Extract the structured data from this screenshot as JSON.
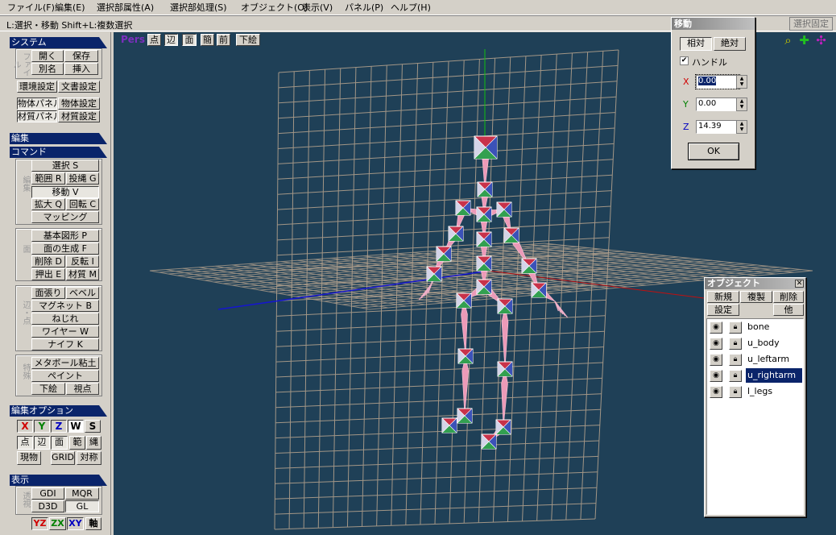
{
  "menubar": {
    "items": [
      "ファイル(F)",
      "編集(E)",
      "選択部属性(A)",
      "選択部処理(S)",
      "オブジェクト(O)",
      "表示(V)",
      "パネル(P)",
      "ヘルプ(H)"
    ]
  },
  "status": {
    "text": "L:選択・移動 Shift+L:複数選択",
    "fixed": "選択固定"
  },
  "left": {
    "system": {
      "title": "システム",
      "group_label": "ファイル",
      "open": "開く",
      "save": "保存",
      "saveas": "別名",
      "insert": "挿入",
      "env": "環境設定",
      "doc": "文書設定",
      "obj_panel": "物体パネル",
      "obj_settings": "物体設定",
      "mat_panel": "材質パネル",
      "mat_settings": "材質設定"
    },
    "edit": {
      "title": "編集"
    },
    "command": {
      "title": "コマンド",
      "g1_label": "編集",
      "select": "選択 S",
      "range": "範囲 R",
      "lasso": "投縄 G",
      "move": "移動 V",
      "scale": "拡大 Q",
      "rotate": "回転 C",
      "mapping": "マッピング",
      "g2_label": "面",
      "basic": "基本図形 P",
      "face_gen": "面の生成 F",
      "delete": "削除 D",
      "invert": "反転 I",
      "extrude": "押出 E",
      "material": "材質 M",
      "g3_label": "辺・点",
      "face_stretch": "面張り",
      "bevel": "ベベル",
      "magnet": "マグネット B",
      "twist": "ねじれ",
      "wire": "ワイヤー W",
      "knife": "ナイフ K",
      "g4_label": "特殊",
      "metaball": "メタボール粘土",
      "paint": "ペイント",
      "underlay": "下絵",
      "viewpoint": "視点"
    },
    "edit_opt": {
      "title": "編集オプション",
      "x": "X",
      "y": "Y",
      "z": "Z",
      "w": "W",
      "s": "S",
      "pt": "点",
      "edge": "辺",
      "face": "面",
      "range": "範",
      "lasso": "縄",
      "current": "現物",
      "grid": "GRID",
      "sym": "対称"
    },
    "display": {
      "title": "表示",
      "group_label": "透視",
      "gdi": "GDI",
      "mqr": "MQR",
      "d3d": "D3D",
      "gl": "GL",
      "yz": "YZ",
      "zx": "ZX",
      "xy": "XY",
      "axis": "軸"
    }
  },
  "view": {
    "pers": "Pers",
    "pt": "点",
    "edge": "辺",
    "face": "面",
    "simple": "簡",
    "front": "前",
    "underlay": "下絵",
    "zoom_icon": "magnifier-icon",
    "move_icon": "pan-arrows-icon",
    "rotate_icon": "rotate-arrows-icon"
  },
  "move_dialog": {
    "title": "移動",
    "relative": "相対",
    "absolute": "絶対",
    "handle": "ハンドル",
    "handle_checked": true,
    "x_label": "X",
    "x_value": "0.00",
    "y_label": "Y",
    "y_value": "0.00",
    "z_label": "Z",
    "z_value": "14.39",
    "ok": "OK"
  },
  "object_panel": {
    "title": "オブジェクト",
    "new": "新規",
    "copy": "複製",
    "delete": "削除",
    "settings": "設定",
    "other": "他",
    "objects": [
      {
        "name": "bone"
      },
      {
        "name": "u_body"
      },
      {
        "name": "u_leftarm"
      },
      {
        "name": "u_rightarm",
        "selected": true
      },
      {
        "name": "l_legs"
      }
    ]
  },
  "colors": {
    "viewport_bg": "#1f4057",
    "grid": "#b9a58f",
    "section_header": "#0a246a",
    "selection": "#0a246a"
  }
}
